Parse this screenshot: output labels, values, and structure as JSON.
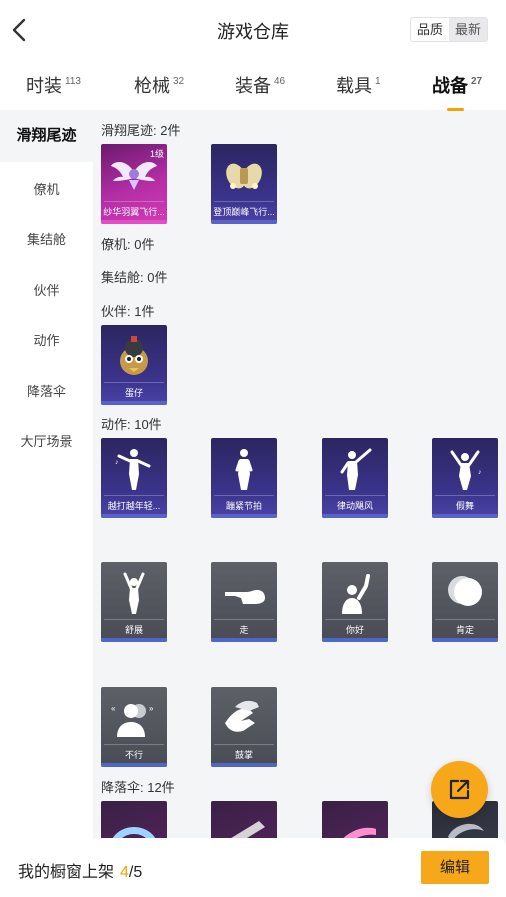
{
  "header": {
    "title": "游戏仓库",
    "sort_quality": "品质",
    "sort_newest": "最新"
  },
  "tabs": [
    {
      "label": "时装",
      "count": "113"
    },
    {
      "label": "枪械",
      "count": "32"
    },
    {
      "label": "装备",
      "count": "46"
    },
    {
      "label": "载具",
      "count": "1"
    },
    {
      "label": "战备",
      "count": "27"
    }
  ],
  "sidebar": {
    "items": [
      {
        "label": "滑翔尾迹"
      },
      {
        "label": "僚机"
      },
      {
        "label": "集结舱"
      },
      {
        "label": "伙伴"
      },
      {
        "label": "动作"
      },
      {
        "label": "降落伞"
      },
      {
        "label": "大厅场景"
      }
    ]
  },
  "sections": {
    "glide": {
      "label": "滑翔尾迹: 2件",
      "items": [
        {
          "name": "纱华羽翼飞行...",
          "badge": "1级"
        },
        {
          "name": "登顶巅峰飞行..."
        }
      ]
    },
    "wingman": {
      "label": "僚机: 0件"
    },
    "pod": {
      "label": "集结舱: 0件"
    },
    "partner": {
      "label": "伙伴: 1件",
      "items": [
        {
          "name": "蛋仔"
        }
      ]
    },
    "emote": {
      "label": "动作: 10件",
      "items": [
        {
          "name": "越打越年轻..."
        },
        {
          "name": "蹦紧节拍"
        },
        {
          "name": "律动飓风"
        },
        {
          "name": "假舞"
        },
        {
          "name": "舒展"
        },
        {
          "name": "走"
        },
        {
          "name": "你好"
        },
        {
          "name": "肯定"
        },
        {
          "name": "不行"
        },
        {
          "name": "鼓掌"
        }
      ]
    },
    "parachute": {
      "label": "降落伞: 12件"
    }
  },
  "bottom": {
    "showcase_label": "我的橱窗上架",
    "showcase_current": "4",
    "showcase_total": "/5",
    "edit_label": "编辑"
  },
  "colors": {
    "accent": "#f6a81a",
    "purple_card": "#3a338a",
    "gray_card": "#4a4c55"
  }
}
